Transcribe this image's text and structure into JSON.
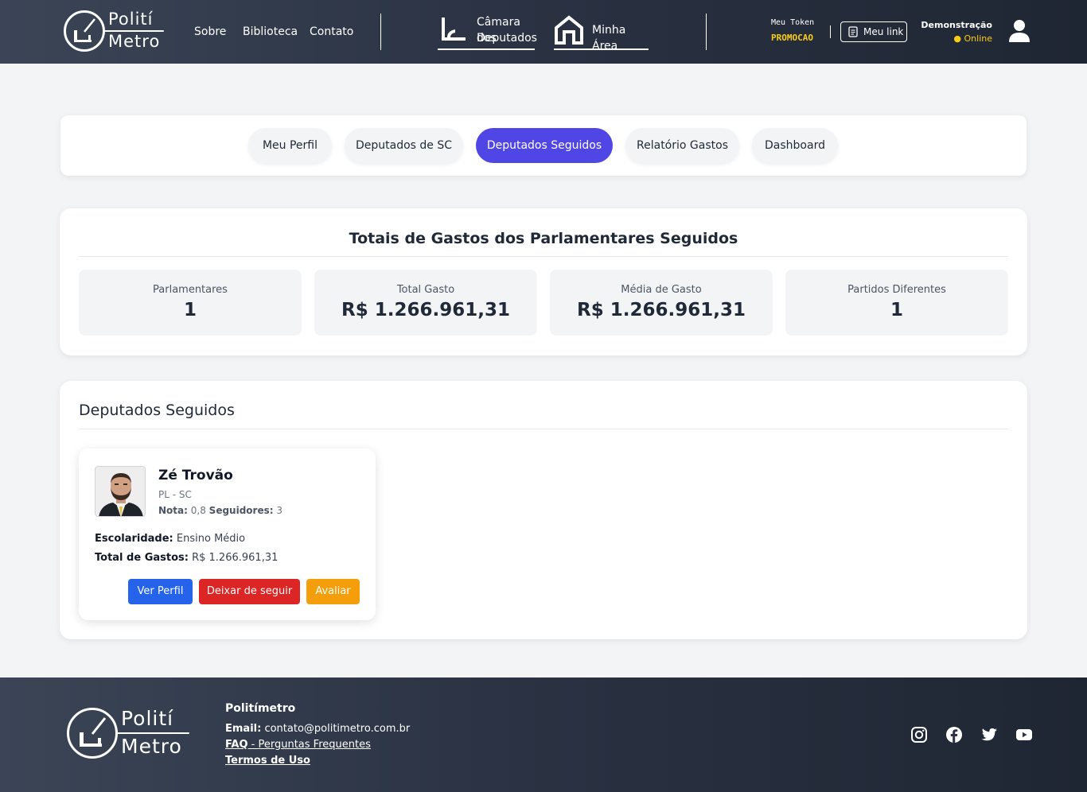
{
  "header": {
    "logo_top": "Polití",
    "logo_bottom": "Metro",
    "nav": [
      "Sobre",
      "Biblioteca",
      "Contato"
    ],
    "camara_line1": "Câmara dos",
    "camara_line2": "Deputados",
    "minha_area": "Minha Área",
    "token_label": "Meu Token",
    "token_value": "PROMOCAO",
    "my_link": "Meu link",
    "user_name": "Demonstração",
    "user_status": "● Online"
  },
  "tabs": [
    "Meu Perfil",
    "Deputados de SC",
    "Deputados Seguidos",
    "Relatório Gastos",
    "Dashboard"
  ],
  "totals": {
    "title": "Totais de Gastos dos Parlamentares Seguidos",
    "stats": [
      {
        "label": "Parlamentares",
        "value": "1"
      },
      {
        "label": "Total Gasto",
        "value": "R$ 1.266.961,31"
      },
      {
        "label": "Média de Gasto",
        "value": "R$ 1.266.961,31"
      },
      {
        "label": "Partidos Diferentes",
        "value": "1"
      }
    ]
  },
  "followed": {
    "title": "Deputados Seguidos",
    "deputy": {
      "name": "Zé Trovão",
      "party": "PL - SC",
      "rating_label": "Nota:",
      "rating": "0,8",
      "followers_label": "Seguidores:",
      "followers": "3",
      "education_label": "Escolaridade:",
      "education": "Ensino Médio",
      "spend_label": "Total de Gastos:",
      "spend": "R$ 1.266.961,31",
      "btn_profile": "Ver Perfil",
      "btn_unfollow": "Deixar de seguir",
      "btn_rate": "Avaliar"
    }
  },
  "footer": {
    "logo_top": "Polití",
    "logo_bottom": "Metro",
    "title": "Politímetro",
    "email_label": "Email:",
    "email": "contato@politimetro.com.br",
    "faq_label": "FAQ",
    "faq_text": " - Perguntas Frequentes",
    "terms": "Termos de Uso",
    "social": [
      "instagram-icon",
      "facebook-icon",
      "twitter-icon",
      "youtube-icon"
    ]
  },
  "colors": {
    "accent": "#4f46e5",
    "btn_blue": "#2563eb",
    "btn_red": "#dc2626",
    "btn_orange": "#f59e0b",
    "token_yellow": "#facc15",
    "header_bg": "#2b3344"
  }
}
